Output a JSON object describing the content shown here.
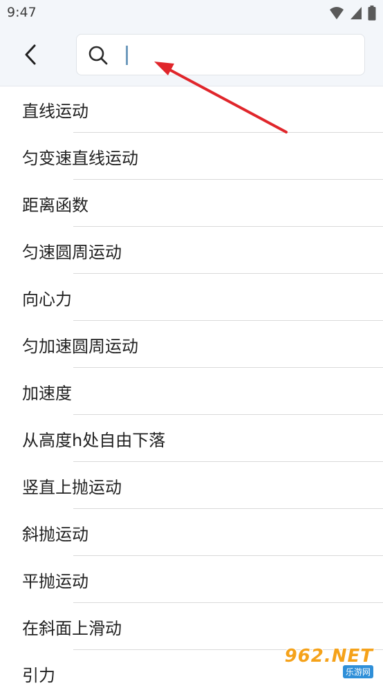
{
  "status_bar": {
    "time": "9:47"
  },
  "header": {
    "back_icon": "chevron-left-icon",
    "search": {
      "icon": "search-icon",
      "value": "",
      "placeholder": ""
    }
  },
  "list": {
    "items": [
      "直线运动",
      "匀变速直线运动",
      "距离函数",
      "匀速圆周运动",
      "向心力",
      "匀加速圆周运动",
      "加速度",
      "从高度h处自由下落",
      "竖直上抛运动",
      "斜抛运动",
      "平抛运动",
      "在斜面上滑动",
      "引力"
    ]
  },
  "annotation": {
    "arrow_color": "#e0262b"
  },
  "watermark": {
    "brand": "962.NET",
    "sub": "乐游网"
  },
  "colors": {
    "header_bg": "#f3f6fa",
    "caret": "#6f9bbd",
    "watermark_orange": "#f5a21a",
    "watermark_blue": "#2f8fd8"
  }
}
